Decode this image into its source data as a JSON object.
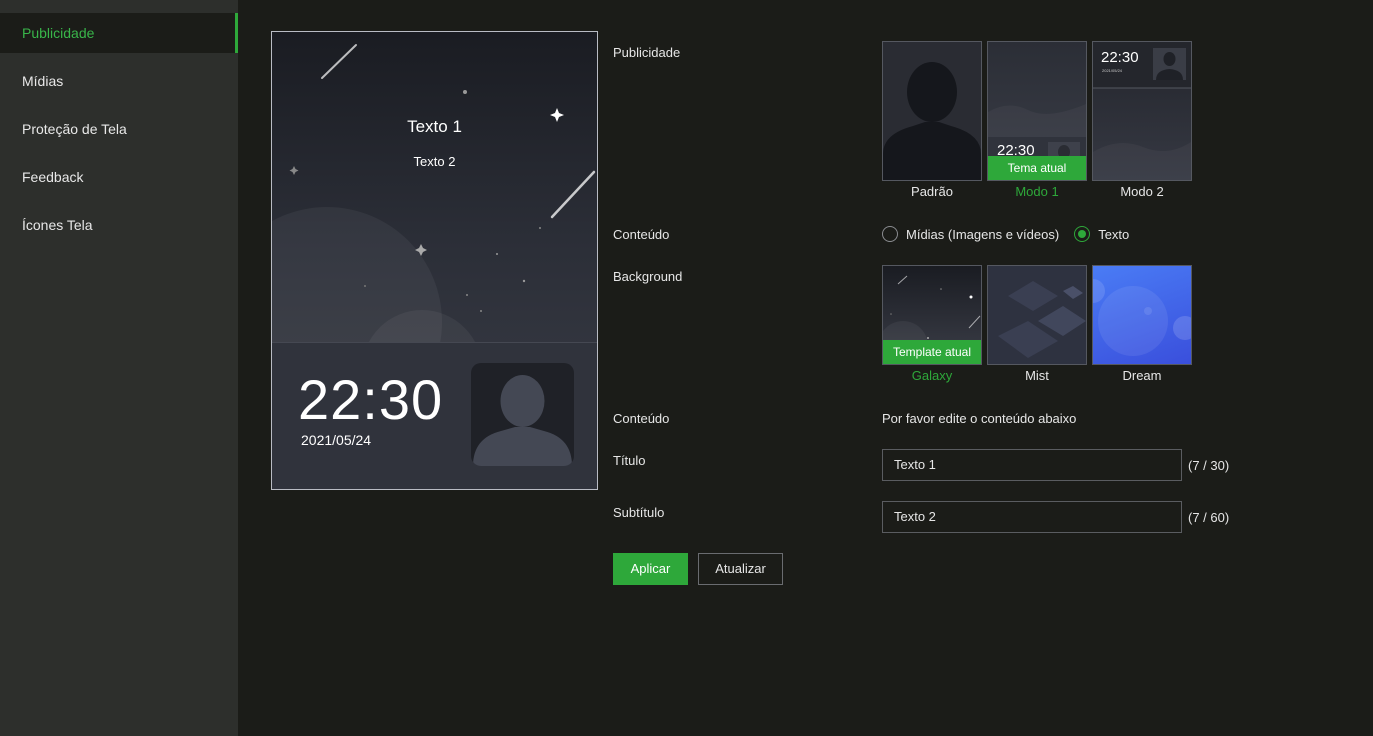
{
  "sidebar": {
    "items": [
      {
        "label": "Publicidade",
        "active": true
      },
      {
        "label": "Mídias"
      },
      {
        "label": "Proteção de Tela"
      },
      {
        "label": "Feedback"
      },
      {
        "label": "Ícones Tela"
      }
    ]
  },
  "preview": {
    "text1": "Texto 1",
    "text2": "Texto 2",
    "clock": "22:30",
    "date": "2021/05/24"
  },
  "form": {
    "publicidade_label": "Publicidade",
    "themes": [
      {
        "name": "Padrão"
      },
      {
        "name": "Modo 1",
        "badge": "Tema atual",
        "selected": true,
        "mini_clock": "22:30"
      },
      {
        "name": "Modo 2",
        "mini_clock": "22:30",
        "mini_date": "2021/05/24"
      }
    ],
    "conteudo_label": "Conteúdo",
    "radio_options": [
      {
        "label": "Mídias (Imagens e vídeos)",
        "checked": false
      },
      {
        "label": "Texto",
        "checked": true
      }
    ],
    "background_label": "Background",
    "backgrounds": [
      {
        "name": "Galaxy",
        "badge": "Template atual",
        "selected": true
      },
      {
        "name": "Mist"
      },
      {
        "name": "Dream"
      }
    ],
    "conteudo2_label": "Conteúdo",
    "conteudo_hint": "Por favor edite o conteúdo abaixo",
    "titulo_label": "Título",
    "titulo_value": "Texto 1",
    "titulo_count": "(7 / 30)",
    "subtitulo_label": "Subtítulo",
    "subtitulo_value": "Texto 2",
    "subtitulo_count": "(7 / 60)",
    "apply_label": "Aplicar",
    "refresh_label": "Atualizar"
  },
  "colors": {
    "accent": "#2ea83a",
    "sidebar_bg": "#2d2f2c",
    "page_bg": "#1b1c18",
    "dream_bg": "#3f63e6"
  }
}
